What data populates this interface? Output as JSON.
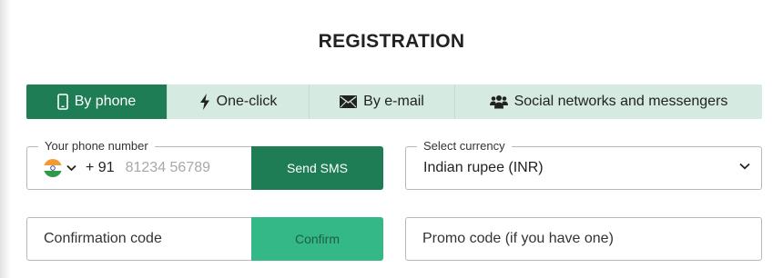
{
  "title": "REGISTRATION",
  "tabs": [
    {
      "label": "By phone",
      "icon": "mobile-phone-icon",
      "active": true
    },
    {
      "label": "One-click",
      "icon": "lightning-bolt-icon",
      "active": false
    },
    {
      "label": "By e-mail",
      "icon": "envelope-icon",
      "active": false
    },
    {
      "label": "Social networks and messengers",
      "icon": "users-group-icon",
      "active": false
    }
  ],
  "phone": {
    "legend": "Your phone number",
    "country_flag": "india-flag-icon",
    "country_code": "+ 91",
    "placeholder": "81234 56789",
    "send_button": "Send SMS"
  },
  "currency": {
    "legend": "Select currency",
    "selected": "Indian rupee (INR)"
  },
  "confirmation": {
    "placeholder": "Confirmation code",
    "button": "Confirm"
  },
  "promo": {
    "placeholder": "Promo code (if you have one)"
  },
  "colors": {
    "accent": "#1e7d55",
    "tab_inactive": "#d5ebe1",
    "confirm_button": "#35b888"
  }
}
